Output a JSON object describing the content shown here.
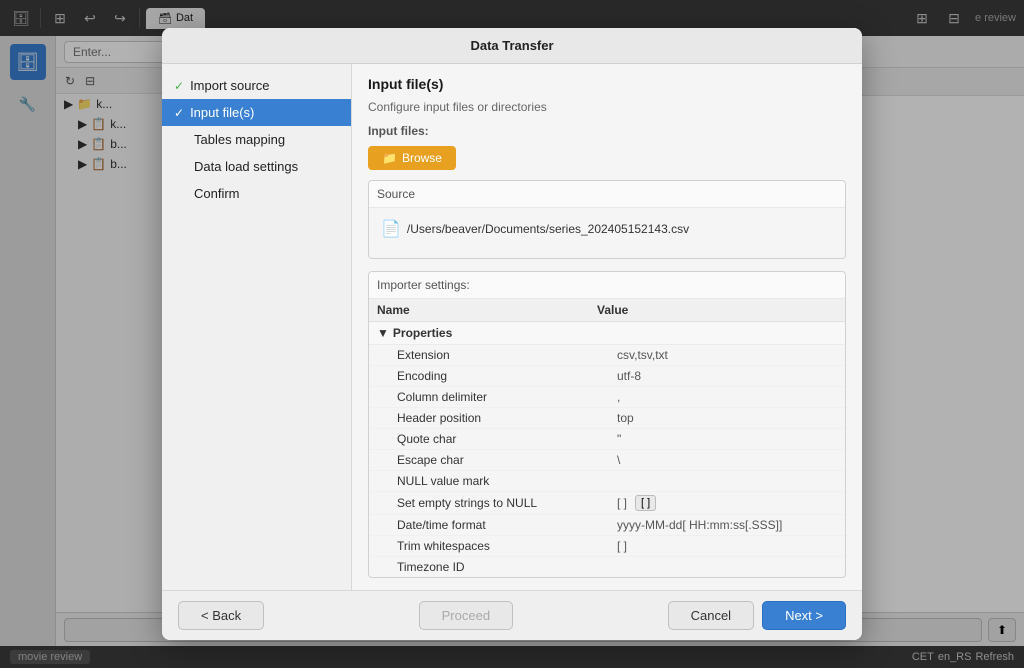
{
  "window": {
    "title": "Data Transfer"
  },
  "titlebar": {
    "close": "×",
    "minimize": "−",
    "maximize": "+"
  },
  "modal": {
    "title": "Data Transfer",
    "header_title": "Input file(s)",
    "header_subtitle": "Configure input files or directories"
  },
  "nav_items": [
    {
      "id": "import-source",
      "label": "Import source",
      "checked": true,
      "active": false
    },
    {
      "id": "input-files",
      "label": "Input file(s)",
      "checked": false,
      "active": true
    },
    {
      "id": "tables-mapping",
      "label": "Tables mapping",
      "checked": false,
      "active": false
    },
    {
      "id": "data-load-settings",
      "label": "Data load settings",
      "checked": false,
      "active": false
    },
    {
      "id": "confirm",
      "label": "Confirm",
      "checked": false,
      "active": false
    }
  ],
  "input_files": {
    "label": "Input files:",
    "browse_label": "Browse"
  },
  "source": {
    "label": "Source",
    "file_path": "/Users/beaver/Documents/series_202405152143.csv"
  },
  "importer_settings": {
    "label": "Importer settings:",
    "columns": {
      "name": "Name",
      "value": "Value"
    },
    "group_label": "Properties",
    "properties": [
      {
        "name": "Extension",
        "value": "csv,tsv,txt",
        "has_btn": false
      },
      {
        "name": "Encoding",
        "value": "utf-8",
        "has_btn": false
      },
      {
        "name": "Column delimiter",
        "value": ",",
        "has_btn": false
      },
      {
        "name": "Header position",
        "value": "top",
        "has_btn": false
      },
      {
        "name": "Quote char",
        "value": "\"",
        "has_btn": false
      },
      {
        "name": "Escape char",
        "value": "\\",
        "has_btn": false
      },
      {
        "name": "NULL value mark",
        "value": "",
        "has_btn": false
      },
      {
        "name": "Set empty strings to NULL",
        "value": "[ ]",
        "has_btn": true,
        "btn_label": "[ ]"
      },
      {
        "name": "Date/time format",
        "value": "yyyy-MM-dd[ HH:mm:ss[.SSS]]",
        "has_btn": false
      },
      {
        "name": "Trim whitespaces",
        "value": "[ ]",
        "has_btn": false
      },
      {
        "name": "Timezone ID",
        "value": "",
        "has_btn": false
      }
    ]
  },
  "footer_buttons": {
    "back": "< Back",
    "proceed": "Proceed",
    "cancel": "Cancel",
    "next": "Next >"
  },
  "status_bar": {
    "tab_label": "movie review",
    "locale": "CET",
    "locale2": "en_RS"
  },
  "outer_tab": {
    "label": "Dat"
  },
  "right_panel_icons": [
    "⊞",
    "⊟"
  ],
  "left_tree_nodes": [
    {
      "label": "k...",
      "indent": false
    },
    {
      "label": "k...",
      "indent": true
    },
    {
      "label": "b...",
      "indent": true
    },
    {
      "label": "b...",
      "indent": true
    }
  ]
}
